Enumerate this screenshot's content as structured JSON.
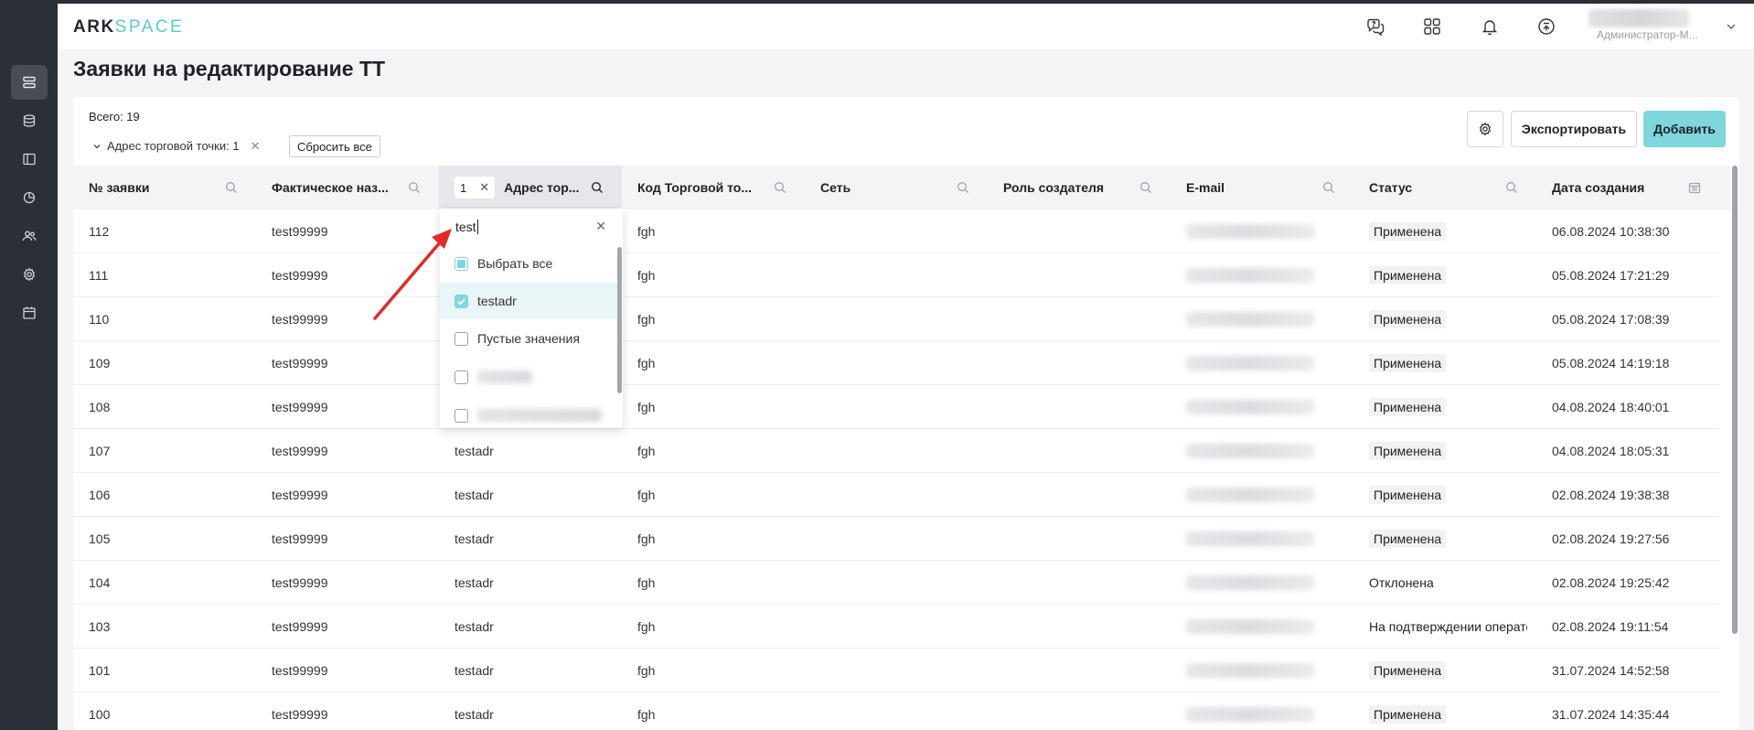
{
  "header": {
    "logo_left": "ARK",
    "logo_right": "SPACE",
    "user_role": "Администратор-М..."
  },
  "page": {
    "title": "Заявки на редактирование ТТ"
  },
  "toolbar": {
    "total": "Всего: 19",
    "filter_chip": "Адрес торговой точки: 1",
    "reset_label": "Сбросить все",
    "export_label": "Экспортировать",
    "add_label": "Добавить"
  },
  "table": {
    "columns": [
      "№ заявки",
      "Фактическое наз...",
      "Адрес тор...",
      "Код Торговой то...",
      "Сеть",
      "Роль создателя",
      "E-mail",
      "Статус",
      "Дата создания"
    ],
    "address_filter_count": "1",
    "rows": [
      {
        "id": "112",
        "name": "test99999",
        "address": "",
        "code": "fgh",
        "status": "Применена",
        "date": "06.08.2024 10:38:30"
      },
      {
        "id": "111",
        "name": "test99999",
        "address": "",
        "code": "fgh",
        "status": "Применена",
        "date": "05.08.2024 17:21:29"
      },
      {
        "id": "110",
        "name": "test99999",
        "address": "",
        "code": "fgh",
        "status": "Применена",
        "date": "05.08.2024 17:08:39"
      },
      {
        "id": "109",
        "name": "test99999",
        "address": "",
        "code": "fgh",
        "status": "Применена",
        "date": "05.08.2024 14:19:18"
      },
      {
        "id": "108",
        "name": "test99999",
        "address": "",
        "code": "fgh",
        "status": "Применена",
        "date": "04.08.2024 18:40:01"
      },
      {
        "id": "107",
        "name": "test99999",
        "address": "testadr",
        "code": "fgh",
        "status": "Применена",
        "date": "04.08.2024 18:05:31"
      },
      {
        "id": "106",
        "name": "test99999",
        "address": "testadr",
        "code": "fgh",
        "status": "Применена",
        "date": "02.08.2024 19:38:38"
      },
      {
        "id": "105",
        "name": "test99999",
        "address": "testadr",
        "code": "fgh",
        "status": "Применена",
        "date": "02.08.2024 19:27:56"
      },
      {
        "id": "104",
        "name": "test99999",
        "address": "testadr",
        "code": "fgh",
        "status": "Отклонена",
        "date": "02.08.2024 19:25:42"
      },
      {
        "id": "103",
        "name": "test99999",
        "address": "testadr",
        "code": "fgh",
        "status": "На подтверждении операто",
        "date": "02.08.2024 19:11:54"
      },
      {
        "id": "101",
        "name": "test99999",
        "address": "testadr",
        "code": "fgh",
        "status": "Применена",
        "date": "31.07.2024 14:52:58"
      },
      {
        "id": "100",
        "name": "test99999",
        "address": "testadr",
        "code": "fgh",
        "status": "Применена",
        "date": "31.07.2024 14:35:44"
      }
    ]
  },
  "dropdown": {
    "search_value": "test",
    "select_all": "Выбрать все",
    "option_selected": "testadr",
    "empty_values": "Пустые значения"
  },
  "colors": {
    "accent": "#7fd6dc",
    "sidebar": "#2b2f36",
    "annotation_arrow": "#e02b2b"
  }
}
